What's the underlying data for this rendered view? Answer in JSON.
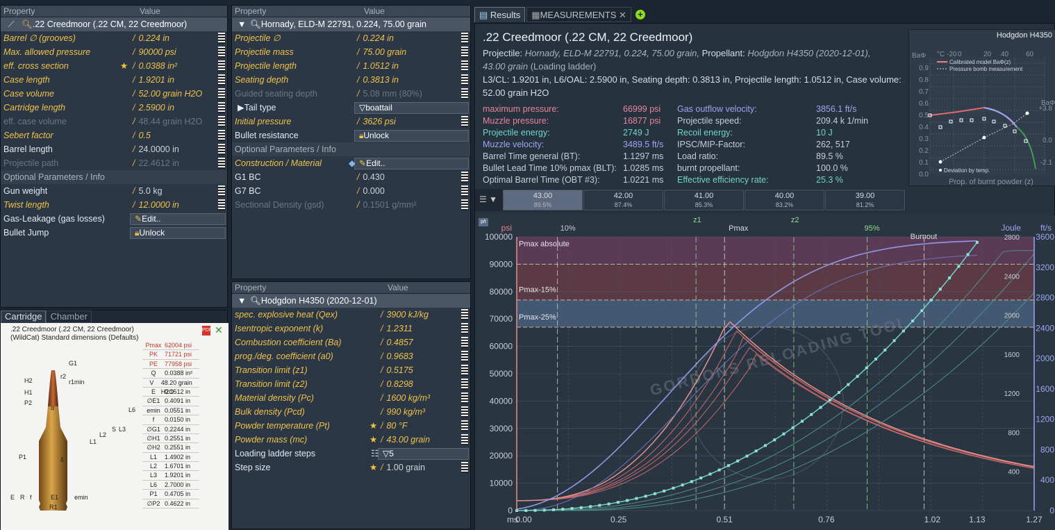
{
  "cartridge_table": {
    "col_property": "Property",
    "col_value": "Value",
    "selected": ".22 Creedmoor (.22 CM, 22 Creedmoor)",
    "rows": [
      {
        "label": "Barrel ∅ (grooves)",
        "value": "0.224 in",
        "style": "yel"
      },
      {
        "label": "Max. allowed pressure",
        "value": "90000 psi",
        "style": "yel"
      },
      {
        "label": "eff. cross section",
        "value": "0.0388 in²",
        "style": "yel",
        "star": true
      },
      {
        "label": "Case length",
        "value": "1.9201 in",
        "style": "yel"
      },
      {
        "label": "Case volume",
        "value": "52.00 grain H2O",
        "style": "yel"
      },
      {
        "label": "Cartridge length",
        "value": "2.5900 in",
        "style": "yel"
      },
      {
        "label": "eff. case volume",
        "value": "48.44 grain H2O",
        "style": "dim"
      },
      {
        "label": "Sebert factor",
        "value": "0.5",
        "style": "yel"
      },
      {
        "label": "Barrel length",
        "value": "24.0000 in",
        "style": "wht"
      },
      {
        "label": "Projectile path",
        "value": "22.4612 in",
        "style": "dim"
      }
    ],
    "optional_header": "Optional Parameters / Info",
    "optional_rows": [
      {
        "label": "Gun weight",
        "value": "5.0 kg",
        "style": "wht"
      },
      {
        "label": "Twist length",
        "value": "12.0000 in",
        "style": "yel"
      },
      {
        "label": "Gas-Leakage (gas losses)",
        "button": "Edit.."
      },
      {
        "label": "Bullet Jump",
        "button": "Unlock"
      }
    ]
  },
  "projectile_table": {
    "col_property": "Property",
    "col_value": "Value",
    "selected": "Hornady, ELD-M 22791, 0.224, 75.00 grain",
    "rows": [
      {
        "label": "Projectile ∅",
        "value": "0.224 in",
        "style": "yel"
      },
      {
        "label": "Projectile mass",
        "value": "75.00 grain",
        "style": "yel"
      },
      {
        "label": "Projectile length",
        "value": "1.0512 in",
        "style": "yel"
      },
      {
        "label": "Seating depth",
        "value": "0.3813 in",
        "style": "yel"
      },
      {
        "label": "Guided seating depth",
        "value": "5.08 mm (80%)",
        "style": "dim"
      },
      {
        "label": "Tail type",
        "value": "boattail",
        "style": "wht",
        "star": true,
        "dropdown": true
      },
      {
        "label": "Initial pressure",
        "value": "3626 psi",
        "style": "yel",
        "star": true
      },
      {
        "label": "Bullet resistance",
        "button": "Unlock"
      }
    ],
    "optional_header": "Optional Parameters / Info",
    "optional_rows": [
      {
        "label": "Construction / Material",
        "button": "Edit..",
        "style": "yel"
      },
      {
        "label": "G1 BC",
        "value": "0.430",
        "style": "wht"
      },
      {
        "label": "G7 BC",
        "value": "0.000",
        "style": "wht"
      },
      {
        "label": "Sectional Density (gsd)",
        "value": "0.1501 g/mm²",
        "style": "dim"
      }
    ]
  },
  "powder_table": {
    "col_property": "Property",
    "col_value": "Value",
    "selected": "Hodgdon H4350 (2020-12-01)",
    "rows": [
      {
        "label": "spec. explosive heat (Qex)",
        "value": "3900 kJ/kg",
        "style": "yel"
      },
      {
        "label": "Isentropic exponent (k)",
        "value": "1.2311",
        "style": "yel"
      },
      {
        "label": "Combustion coefficient (Ba)",
        "value": "0.4857",
        "style": "yel"
      },
      {
        "label": "prog./deg. coefficient (a0)",
        "value": "0.9683",
        "style": "yel"
      },
      {
        "label": "Transition limit (z1)",
        "value": "0.5175",
        "style": "yel"
      },
      {
        "label": "Transition limit (z2)",
        "value": "0.8298",
        "style": "yel"
      },
      {
        "label": "Material density (Pc)",
        "value": "1600 kg/m³",
        "style": "yel"
      },
      {
        "label": "Bulk density (Pcd)",
        "value": "990 kg/m³",
        "style": "yel"
      },
      {
        "label": "Powder temperature (Pt)",
        "value": "80 °F",
        "style": "yel",
        "star": true
      },
      {
        "label": "Powder mass (mc)",
        "value": "43.00 grain",
        "style": "yel",
        "star": true
      },
      {
        "label": "Loading ladder steps",
        "value": "5",
        "style": "wht",
        "dropdown": true
      },
      {
        "label": "Step size",
        "value": "1.00 grain",
        "style": "wht",
        "star": true
      }
    ]
  },
  "cartridge_view": {
    "tabs": [
      "Cartridge",
      "Chamber"
    ],
    "title": ".22 Creedmoor (.22 CM, 22 Creedmoor)",
    "subtitle": "(WildCat) Standard dimensions (Defaults)",
    "dims": [
      [
        "Pmax",
        "62004 psi"
      ],
      [
        "PK",
        "71721 psi"
      ],
      [
        "PE",
        "77958 psi"
      ],
      [
        "Q",
        "0.0388 in²"
      ],
      [
        "V",
        "48.20 grain H2O"
      ],
      [
        "E",
        "0.1512 in"
      ],
      [
        "∅E1",
        "0.4091 in"
      ],
      [
        "emin",
        "0.0551 in"
      ],
      [
        "f",
        "0.0150 in"
      ],
      [
        "∅G1",
        "0.2244 in"
      ],
      [
        "∅H1",
        "0.2551 in"
      ],
      [
        "∅H2",
        "0.2551 in"
      ],
      [
        "L1",
        "1.4902 in"
      ],
      [
        "L2",
        "1.6701 in"
      ],
      [
        "L3",
        "1.9201 in"
      ],
      [
        "L6",
        "2.7000 in"
      ],
      [
        "P1",
        "0.4705 in"
      ],
      [
        "∅P2",
        "0.4622 in"
      ]
    ],
    "labels": [
      "G1",
      "r2",
      "H2",
      "r1min",
      "H1",
      "P2",
      "α",
      "L6",
      "S",
      "L3",
      "L2",
      "L1",
      "δ",
      "P1",
      "E",
      "R",
      "f",
      "E1",
      "emin",
      "R1"
    ]
  },
  "results": {
    "tabs": [
      "Results",
      "MEASUREMENTS"
    ],
    "title": ".22 Creedmoor (.22 CM, 22 Creedmoor)",
    "line1_a": "Projectile:",
    "line1_b": "Hornady, ELD-M 22791, 0.224, 75.00 grain,",
    "line1_c": "Propellant:",
    "line1_d": "Hodgdon H4350 (2020-12-01),",
    "line2_a": "43.00 grain",
    "line2_b": "(Loading ladder)",
    "line3": "L3/CL: 1.9201 in, L6/OAL: 2.5900 in, Seating depth: 0.3813 in, Projectile length: 1.0512 in, Case volume: 52.00 grain H2O",
    "left": [
      [
        "maximum pressure:",
        "66999 psi",
        "pink"
      ],
      [
        "Muzzle pressure:",
        "16877 psi",
        "pink"
      ],
      [
        "Projectile energy:",
        "2749 J",
        "teal"
      ],
      [
        "Muzzle velocity:",
        "3489.5 ft/s",
        "blue"
      ],
      [
        "Barrel Time general (BT):",
        "1.1297 ms",
        ""
      ],
      [
        "Bullet Lead Time 10% pmax (BLT):",
        "1.0285 ms",
        ""
      ],
      [
        "Optimal Barrel Time (OBT #3):",
        "1.0221 ms",
        ""
      ]
    ],
    "right": [
      [
        "Gas outflow velocity:",
        "3856.1 ft/s",
        "blue"
      ],
      [
        "Projectile speed:",
        "209.4 k 1/min",
        ""
      ],
      [
        "Recoil energy:",
        "10 J",
        "teal"
      ],
      [
        "IPSC/MIP-Factor:",
        "262, 517",
        ""
      ],
      [
        "Load ratio:",
        "89.5 %",
        ""
      ],
      [
        "burnt propellant:",
        "100.0 %",
        ""
      ],
      [
        "Effective efficiency rate:",
        "25.3 %",
        "teal"
      ]
    ]
  },
  "mini_chart": {
    "title": "Hodgdon H4350",
    "legend": [
      "Calibrated model BaΦ(z)",
      "Pressure bomb measurement"
    ],
    "xlabel": "Prop. of burnt powder (z)",
    "top_axis": [
      "°C -20",
      "0",
      "20",
      "40",
      "60"
    ],
    "y_left": [
      "0.9",
      "0.8",
      "0.7",
      "0.6",
      "0.5",
      "0.4",
      "0.3",
      "0.2",
      "0.1",
      "0.0"
    ],
    "y_right": [
      "+3.8",
      "0.0",
      "-2.1"
    ],
    "ba": "BaΦ",
    "note": "Deviation by temp."
  },
  "ladder": [
    {
      "v": "43.00",
      "p": "89.5%"
    },
    {
      "v": "42.00",
      "p": "87.4%"
    },
    {
      "v": "41.00",
      "p": "85.3%"
    },
    {
      "v": "40.00",
      "p": "83.2%"
    },
    {
      "v": "39.00",
      "p": "81.2%"
    }
  ],
  "chart_data": {
    "type": "line",
    "xlabel": "ms",
    "x_ticks": [
      "0.00",
      "0.25",
      "0.51",
      "0.76",
      "1.02",
      "1.13",
      "1.27"
    ],
    "ylabel_left": "psi",
    "ylabel_joule": "Joule",
    "ylabel_fts": "ft/s",
    "ylim": [
      0,
      100000
    ],
    "y_ticks": [
      "100000",
      "90000",
      "80000",
      "70000",
      "60000",
      "50000",
      "40000",
      "30000",
      "20000",
      "10000",
      "0"
    ],
    "joule_ticks": [
      "2800",
      "2400",
      "2000",
      "1600",
      "1200",
      "800",
      "400"
    ],
    "fts_ticks": [
      "3600",
      "3200",
      "2800",
      "2400",
      "2000",
      "1600",
      "1200",
      "800",
      "400",
      "0"
    ],
    "markers": [
      "10%",
      "z1",
      "Pmax",
      "z2",
      "95%",
      "Burnout"
    ],
    "bands": [
      "Pmax absolute",
      "Pmax-15%",
      "Pmax-25%"
    ],
    "watermark": "GORDONS RELOADING TOOL",
    "series": [
      {
        "name": "pressure",
        "color": "#e8908a",
        "points": [
          [
            0,
            3626
          ],
          [
            0.1,
            6000
          ],
          [
            0.2,
            12000
          ],
          [
            0.3,
            25000
          ],
          [
            0.4,
            45000
          ],
          [
            0.5,
            66999
          ],
          [
            0.6,
            60000
          ],
          [
            0.7,
            45000
          ],
          [
            0.8,
            35000
          ],
          [
            0.9,
            27000
          ],
          [
            1.0,
            22000
          ],
          [
            1.13,
            16877
          ],
          [
            1.27,
            12000
          ]
        ]
      },
      {
        "name": "velocity",
        "color": "#8e9ae6",
        "points": [
          [
            0,
            0
          ],
          [
            0.2,
            300
          ],
          [
            0.4,
            1100
          ],
          [
            0.6,
            2000
          ],
          [
            0.8,
            2700
          ],
          [
            1.0,
            3200
          ],
          [
            1.13,
            3489
          ]
        ]
      },
      {
        "name": "energy",
        "color": "#6fd4c9",
        "points": [
          [
            0,
            0
          ],
          [
            0.3,
            50
          ],
          [
            0.5,
            300
          ],
          [
            0.7,
            900
          ],
          [
            0.9,
            1700
          ],
          [
            1.13,
            2749
          ]
        ]
      }
    ]
  }
}
